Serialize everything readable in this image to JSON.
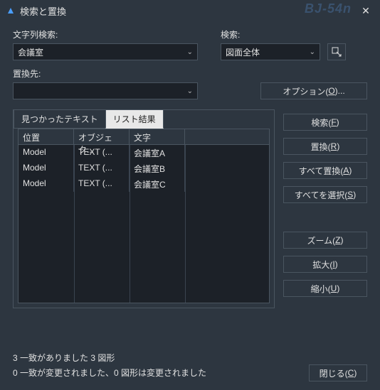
{
  "window": {
    "title": "検索と置換"
  },
  "labels": {
    "find": "文字列検索:",
    "scope": "検索:",
    "replace": "置換先:"
  },
  "fields": {
    "find_value": "会議室",
    "scope_value": "図面全体",
    "replace_value": ""
  },
  "buttons": {
    "options": "オプション(",
    "options_m": "O",
    "options_suffix": ")...",
    "search": "検索(",
    "search_m": "F",
    "replace": "置換(",
    "replace_m": "R",
    "replace_all": "すべて置換(",
    "replace_all_m": "A",
    "select_all": "すべてを選択(",
    "select_all_m": "S",
    "zoom": "ズーム(",
    "zoom_m": "Z",
    "zoom_in": "拡大(",
    "zoom_in_m": "I",
    "zoom_out": "縮小(",
    "zoom_out_m": "U",
    "close": "閉じる(",
    "close_m": "C",
    "paren": ")"
  },
  "tabs": {
    "found": "見つかったテキスト",
    "list": "リスト結果"
  },
  "table": {
    "headers": [
      "位置",
      "オブジェク...",
      "文字"
    ],
    "rows": [
      [
        "Model",
        "TEXT (...",
        "会議室A"
      ],
      [
        "Model",
        "TEXT (...",
        "会議室B"
      ],
      [
        "Model",
        "TEXT (...",
        "会議室C"
      ]
    ]
  },
  "status": {
    "line1": "3 一致がありました 3 図形",
    "line2": "0 一致が変更されました、0 図形は変更されました"
  }
}
